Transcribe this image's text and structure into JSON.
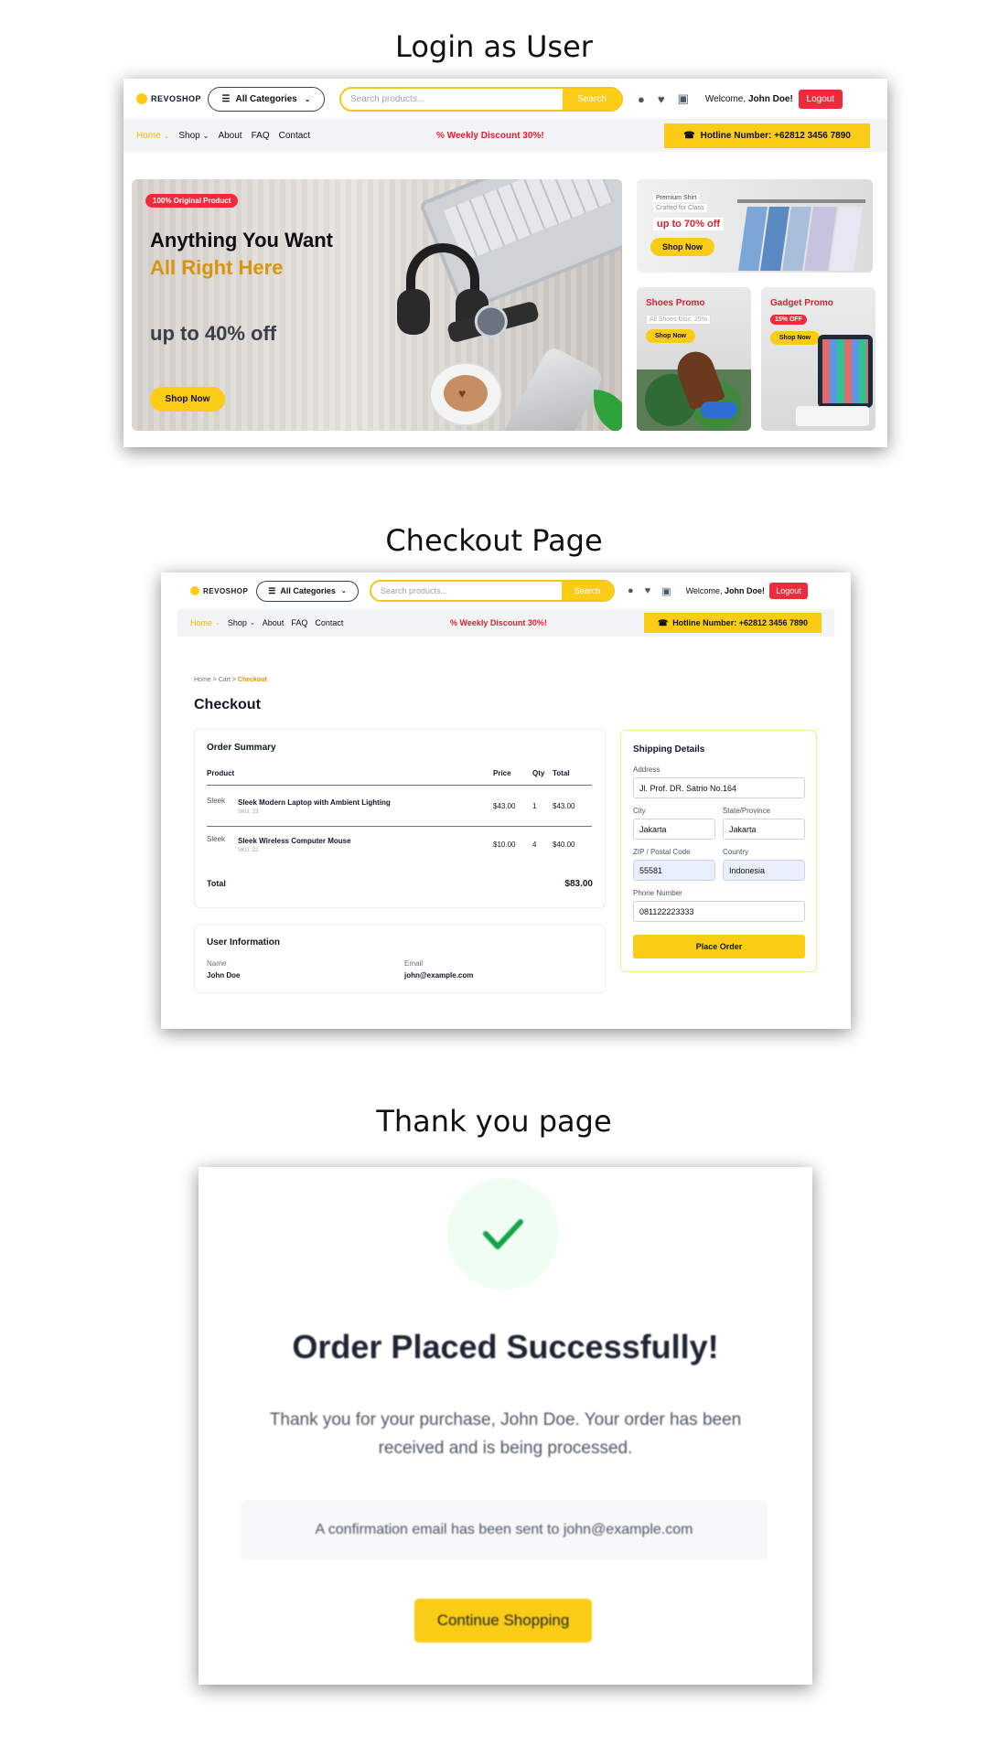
{
  "sections": {
    "login": "Login as User",
    "checkout": "Checkout Page",
    "thanks": "Thank you page"
  },
  "navbar": {
    "logo": "REVOSHOP",
    "categories": "All Categories",
    "search_placeholder": "Search products...",
    "search_button": "Search",
    "welcome": "Welcome,",
    "user_name": "John Doe!",
    "logout": "Logout",
    "nav": [
      "Home",
      "Shop",
      "About",
      "FAQ",
      "Contact"
    ],
    "discount": "Weekly Discount 30%!",
    "hotline": "Hotline Number: +62812 3456 7890"
  },
  "hero": {
    "badge": "100% Original Product",
    "headline1": "Anything You Want",
    "headline2": "All Right Here",
    "offer": "up to 40% off",
    "cta": "Shop Now",
    "side1_line1": "Premium Shirt",
    "side1_line2": "Crafted for Class",
    "side1_offer": "up to 70% off",
    "side1_cta": "Shop Now",
    "shoes_title": "Shoes Promo",
    "shoes_sub": "All Shoes Disc. 25%",
    "shoes_cta": "Shop Now",
    "gadget_title": "Gadget Promo",
    "gadget_badge": "15% OFF",
    "gadget_cta": "Shop Now"
  },
  "checkout": {
    "breadcrumb": {
      "home": "Home",
      "sep": ">",
      "cart": "Cart",
      "current": "Checkout"
    },
    "title": "Checkout",
    "order_summary": "Order Summary",
    "columns": [
      "Product",
      "Price",
      "Qty",
      "Total"
    ],
    "items": [
      {
        "alt": "Sleek",
        "name": "Sleek Modern Laptop with Ambient Lighting",
        "sku": "SKU: 23",
        "price": "$43.00",
        "qty": "1",
        "total": "$43.00"
      },
      {
        "alt": "Sleek",
        "name": "Sleek Wireless Computer Mouse",
        "sku": "SKU: 22",
        "price": "$10.00",
        "qty": "4",
        "total": "$40.00"
      }
    ],
    "total_label": "Total",
    "total_value": "$83.00",
    "user_info": "User Information",
    "name_label": "Name",
    "name_value": "John Doe",
    "email_label": "Email",
    "email_value": "john@example.com",
    "shipping": "Shipping Details",
    "address_label": "Address",
    "address_value": "Jl. Prof. DR. Satrio No.164",
    "city_label": "City",
    "city_value": "Jakarta",
    "state_label": "State/Province",
    "state_value": "Jakarta",
    "zip_label": "ZIP / Postal Code",
    "zip_value": "55581",
    "country_label": "Country",
    "country_value": "Indonesia",
    "phone_label": "Phone Number",
    "phone_value": "081122223333",
    "place_order": "Place Order"
  },
  "thanks": {
    "title": "Order Placed Successfully!",
    "message": "Thank you for your purchase, John Doe. Your order has been received and is being processed.",
    "email_note": "A confirmation email has been sent to john@example.com",
    "continue": "Continue Shopping"
  },
  "colors": {
    "accent": "#facc15",
    "danger": "#ef2b3b",
    "success": "#16a34a"
  }
}
